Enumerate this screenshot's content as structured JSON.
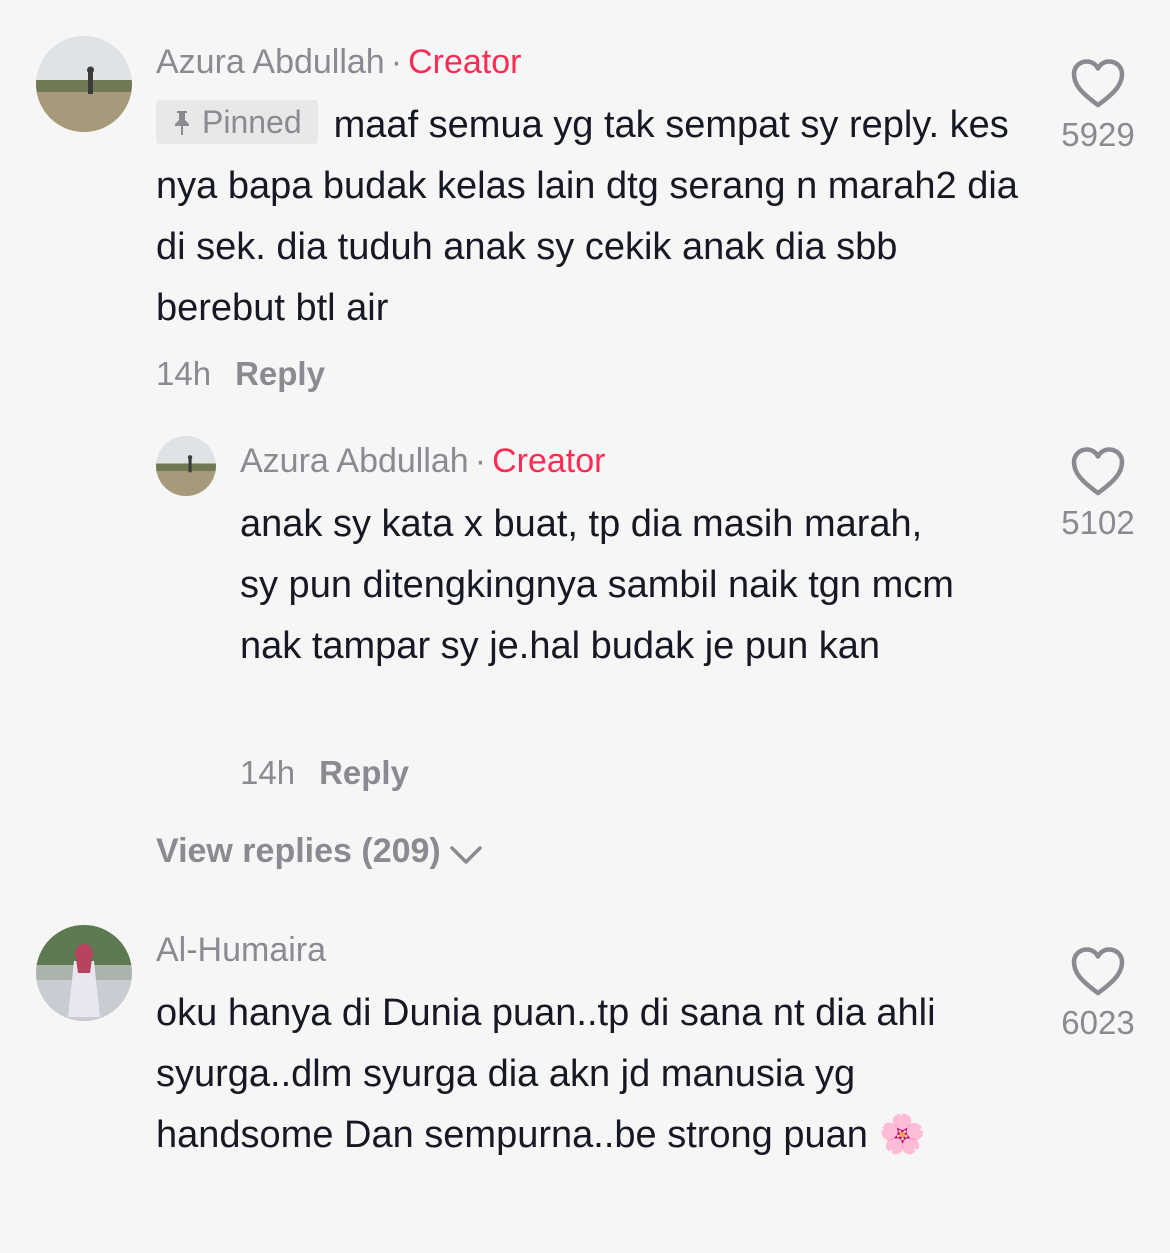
{
  "comments": [
    {
      "author": "Azura Abdullah",
      "separator": "·",
      "badge": "Creator",
      "pinned_label": "Pinned",
      "text": "maaf semua yg tak sempat sy reply. kes nya bapa budak kelas lain dtg serang n marah2 dia di sek. dia tuduh anak sy cekik anak dia sbb berebut btl air",
      "time": "14h",
      "reply_label": "Reply",
      "likes": "5929",
      "reply": {
        "author": "Azura Abdullah",
        "separator": "·",
        "badge": "Creator",
        "text": "anak sy kata x buat, tp dia masih marah, sy pun ditengkingnya sambil naik tgn mcm nak tampar sy je.hal budak je pun kan",
        "time": "14h",
        "reply_label": "Reply",
        "likes": "5102"
      },
      "view_replies": "View replies (209)"
    },
    {
      "author": "Al-Humaira",
      "text": "oku hanya di Dunia puan..tp di sana nt dia ahli syurga..dlm syurga dia akn jd manusia yg handsome Dan sempurna..be strong puan 🌸",
      "likes": "6023"
    }
  ],
  "icons": {
    "like": "heart-outline-icon",
    "pin": "pin-icon",
    "chevron": "chevron-down-icon"
  },
  "colors": {
    "creator": "#fe2c55",
    "muted": "#8a8b91",
    "text": "#161823",
    "background": "#f6f6f6"
  }
}
